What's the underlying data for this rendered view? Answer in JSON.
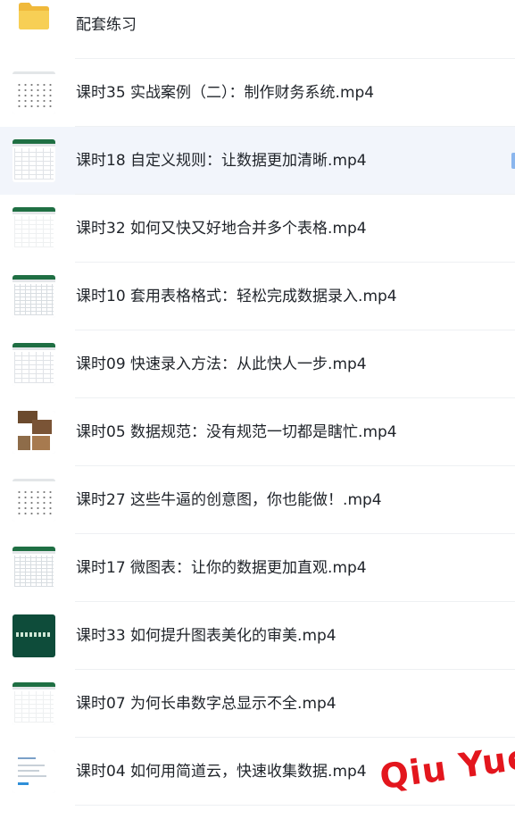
{
  "folder": {
    "label": "配套练习",
    "icon": "folder-icon"
  },
  "files": [
    {
      "label": "课时35 实战案例（二）：制作财务系统.mp4",
      "thumb": "spreadsheet-dots",
      "selected": false
    },
    {
      "label": "课时18 自定义规则：让数据更加清晰.mp4",
      "thumb": "spreadsheet",
      "selected": true
    },
    {
      "label": "课时32 如何又快又好地合并多个表格.mp4",
      "thumb": "spreadsheet-light",
      "selected": false
    },
    {
      "label": "课时10 套用表格格式：轻松完成数据录入.mp4",
      "thumb": "spreadsheet-dense",
      "selected": false
    },
    {
      "label": "课时09 快速录入方法：从此快人一步.mp4",
      "thumb": "spreadsheet",
      "selected": false
    },
    {
      "label": "课时05 数据规范：没有规范一切都是瞎忙.mp4",
      "thumb": "photo-collage",
      "selected": false
    },
    {
      "label": "课时27 这些牛逼的创意图，你也能做！.mp4",
      "thumb": "spreadsheet-dots",
      "selected": false
    },
    {
      "label": "课时17 微图表：让你的数据更加直观.mp4",
      "thumb": "spreadsheet-dense",
      "selected": false
    },
    {
      "label": "课时33 如何提升图表美化的审美.mp4",
      "thumb": "green-slide",
      "selected": false
    },
    {
      "label": "课时07 为何长串数字总显示不全.mp4",
      "thumb": "spreadsheet-light",
      "selected": false
    },
    {
      "label": "课时04 如何用简道云，快速收集数据.mp4",
      "thumb": "web-form",
      "selected": false
    }
  ],
  "watermark": "Qiu Yue",
  "colors": {
    "accent": "#8bb6ee",
    "selected_bg": "#f2f5fb",
    "folder": "#f5c84c",
    "watermark": "#e3161d",
    "excel_green": "#1f6f43"
  }
}
